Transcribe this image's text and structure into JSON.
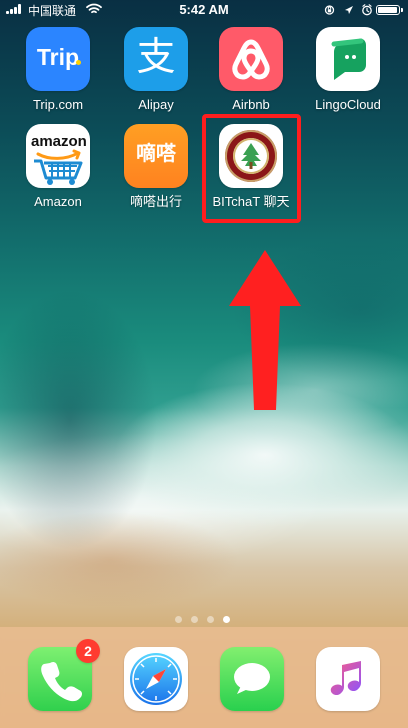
{
  "status_bar": {
    "carrier": "中国联通",
    "time": "5:42 AM",
    "battery_level": 0.95
  },
  "home_screen": {
    "apps": [
      {
        "label": "Trip.com",
        "icon": "trip-com-icon",
        "text": "Trip"
      },
      {
        "label": "Alipay",
        "icon": "alipay-icon",
        "text": "支"
      },
      {
        "label": "Airbnb",
        "icon": "airbnb-icon"
      },
      {
        "label": "LingoCloud",
        "icon": "lingocloud-icon"
      },
      {
        "label": "Amazon",
        "icon": "amazon-icon",
        "text": "amazon"
      },
      {
        "label": "嘀嗒出行",
        "icon": "dida-icon",
        "text": "嘀嗒"
      },
      {
        "label": "BITchaT 聊天",
        "icon": "bitchat-icon"
      }
    ]
  },
  "page_indicator": {
    "count": 4,
    "active_index": 3
  },
  "dock": {
    "apps": [
      {
        "icon": "phone-icon",
        "badge": "2"
      },
      {
        "icon": "safari-icon"
      },
      {
        "icon": "messages-icon"
      },
      {
        "icon": "music-icon"
      }
    ]
  },
  "colors": {
    "highlight": "#ff1e1e",
    "badge": "#ff3b30"
  }
}
